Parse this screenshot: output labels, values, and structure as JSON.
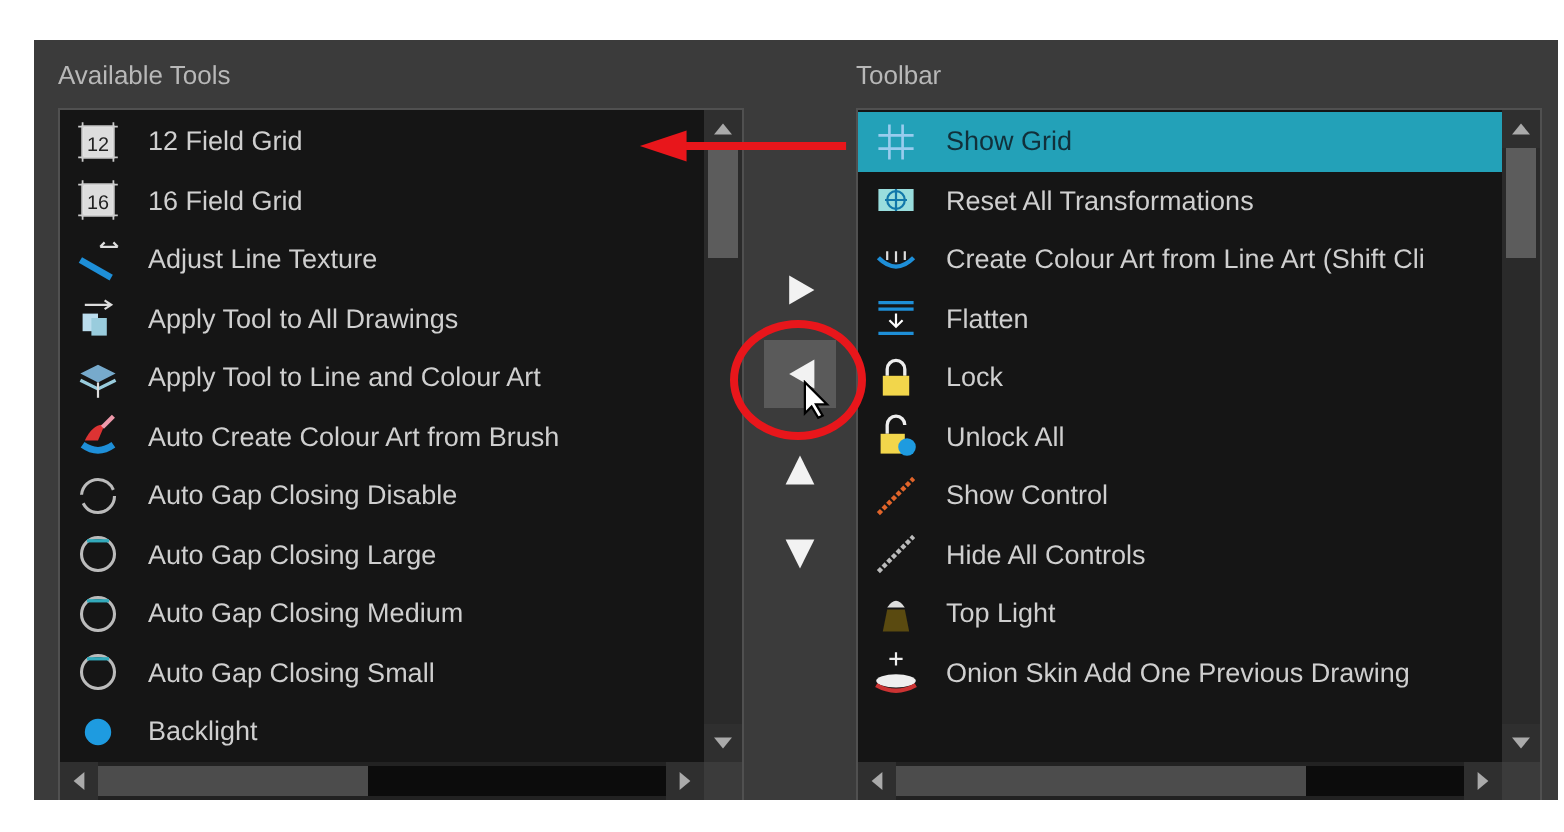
{
  "available_tools": {
    "label": "Available Tools",
    "items": [
      {
        "label": "12 Field Grid",
        "icon_label": "12",
        "selected": false
      },
      {
        "label": "16 Field Grid",
        "icon_label": "16",
        "selected": false
      },
      {
        "label": "Adjust Line Texture",
        "selected": false
      },
      {
        "label": "Apply Tool to All Drawings",
        "selected": false
      },
      {
        "label": "Apply Tool to Line and Colour Art",
        "selected": false
      },
      {
        "label": "Auto Create Colour Art from Brush",
        "selected": false
      },
      {
        "label": "Auto Gap Closing Disable",
        "selected": false
      },
      {
        "label": "Auto Gap Closing Large",
        "selected": false
      },
      {
        "label": "Auto Gap Closing Medium",
        "selected": false
      },
      {
        "label": "Auto Gap Closing Small",
        "selected": false
      },
      {
        "label": "Backlight",
        "selected": false
      }
    ]
  },
  "move_buttons": [
    {
      "kind": "right",
      "pressed": false
    },
    {
      "kind": "left",
      "pressed": true
    },
    {
      "kind": "up",
      "pressed": false
    },
    {
      "kind": "down",
      "pressed": false
    }
  ],
  "toolbar": {
    "label": "Toolbar",
    "items": [
      {
        "label": "Show Grid",
        "selected": true
      },
      {
        "label": "Reset All Transformations",
        "selected": false
      },
      {
        "label": "Create Colour Art from Line Art (Shift Cli",
        "selected": false
      },
      {
        "label": "Flatten",
        "selected": false
      },
      {
        "label": "Lock",
        "selected": false
      },
      {
        "label": "Unlock All",
        "selected": false
      },
      {
        "label": "Show Control",
        "selected": false
      },
      {
        "label": "Hide All Controls",
        "selected": false
      },
      {
        "label": "Top Light",
        "selected": false
      },
      {
        "label": "Onion Skin Add One Previous Drawing",
        "selected": false
      }
    ]
  }
}
